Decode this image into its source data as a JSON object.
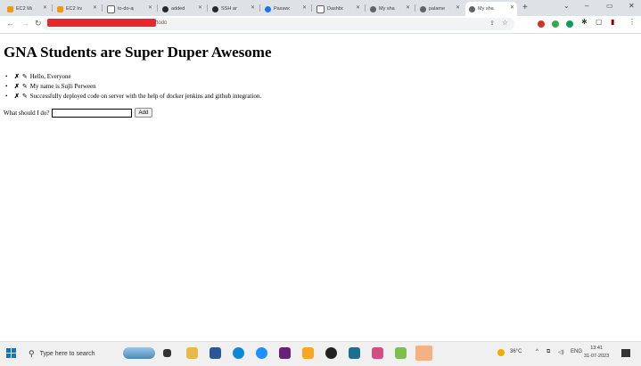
{
  "browser": {
    "tabs": [
      {
        "label": "EC2 Ma",
        "color": "#f29900"
      },
      {
        "label": "EC2 Ins",
        "color": "#f29900"
      },
      {
        "label": "to-do-ap",
        "color": "#5f6368"
      },
      {
        "label": "added",
        "color": "#24292f"
      },
      {
        "label": "SSH an",
        "color": "#24292f"
      },
      {
        "label": "Passwo",
        "color": "#1a73e8"
      },
      {
        "label": "Dashbo",
        "color": "#5f6368"
      },
      {
        "label": "My sha",
        "color": "#5f6368"
      },
      {
        "label": "palame",
        "color": "#5f6368"
      },
      {
        "label": "My sha",
        "color": "#5f6368",
        "active": true
      }
    ],
    "url": "/todo"
  },
  "page": {
    "title": "GNA Students are Super Duper Awesome",
    "todos": [
      {
        "delete": "✗",
        "edit": "✎",
        "text": "Hello, Everyone"
      },
      {
        "delete": "✗",
        "edit": "✎",
        "text": "My name is Sujli Perween"
      },
      {
        "delete": "✗",
        "edit": "✎",
        "text": "Successfully deployed code on server with the help of docker jenkins and github integration."
      }
    ],
    "form": {
      "label": "What should I do?",
      "value": "",
      "button": "Add"
    }
  },
  "taskbar": {
    "search_placeholder": "Type here to search",
    "temperature": "36°C",
    "language": "ENG",
    "time": "13:41",
    "date": "31-07-2023"
  }
}
